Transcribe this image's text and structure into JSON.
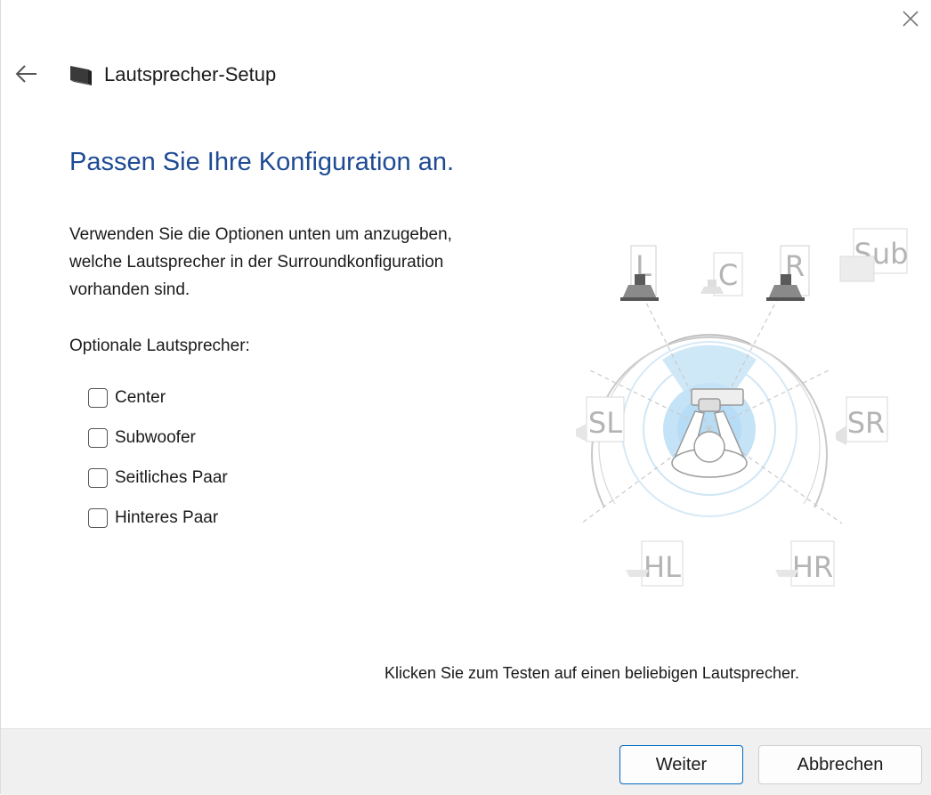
{
  "window": {
    "title": "Lautsprecher-Setup",
    "icons": {
      "close": "close-icon",
      "back": "back-arrow-icon",
      "app": "speaker-app-icon"
    }
  },
  "main": {
    "heading": "Passen Sie Ihre Konfiguration an.",
    "description": "Verwenden Sie die Optionen unten um anzugeben,\nwelche Lautsprecher in der Surroundkonfiguration\nvorhanden sind.",
    "optional_label": "Optionale Lautsprecher:",
    "options": [
      {
        "label": "Center",
        "checked": false
      },
      {
        "label": "Subwoofer",
        "checked": false
      },
      {
        "label": "Seitliches Paar",
        "checked": false
      },
      {
        "label": "Hinteres Paar",
        "checked": false
      }
    ]
  },
  "diagram": {
    "speakers": {
      "left": "L",
      "center": "C",
      "right": "R",
      "sub": "Sub",
      "side_left": "SL",
      "side_right": "SR",
      "rear_left": "HL",
      "rear_right": "HR"
    },
    "hint": "Klicken Sie zum Testen auf einen beliebigen Lautsprecher."
  },
  "footer": {
    "next_label": "Weiter",
    "cancel_label": "Abbrechen"
  },
  "colors": {
    "heading": "#1e4b94",
    "accent": "#0067c0",
    "footer_bg": "#f0f0f0",
    "zone_blue": "#cfe8f8"
  }
}
